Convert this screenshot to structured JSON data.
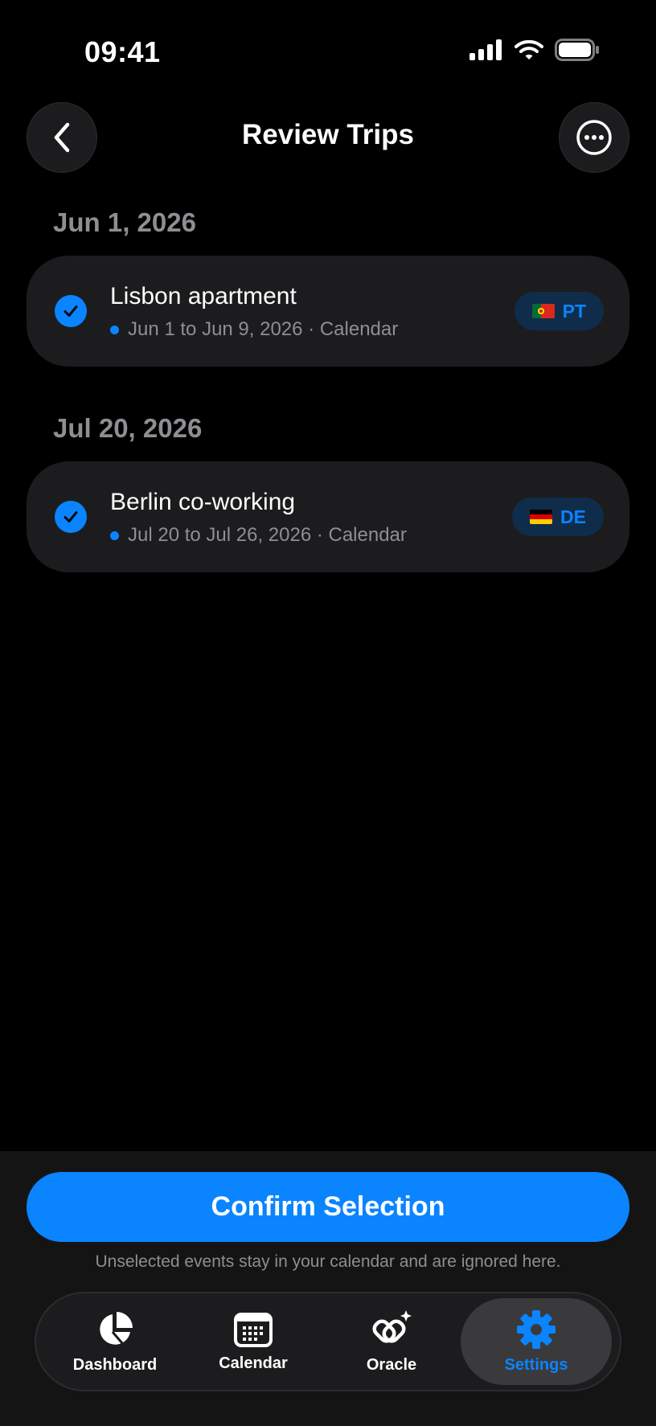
{
  "status_bar": {
    "time": "09:41"
  },
  "nav": {
    "title": "Review Trips"
  },
  "sections": [
    {
      "date": "Jun 1, 2026",
      "trip": {
        "title": "Lisbon apartment",
        "subtitle": "Jun 1 to Jun 9, 2026 · Calendar",
        "country_code": "PT",
        "selected": true
      }
    },
    {
      "date": "Jul 20, 2026",
      "trip": {
        "title": "Berlin co-working",
        "subtitle": "Jul 20 to Jul 26, 2026 · Calendar",
        "country_code": "DE",
        "selected": true
      }
    }
  ],
  "footer": {
    "confirm_label": "Confirm Selection",
    "hint": "Unselected events stay in your calendar and are ignored here."
  },
  "tabs": [
    {
      "label": "Dashboard",
      "icon": "pie-chart-icon",
      "active": false
    },
    {
      "label": "Calendar",
      "icon": "calendar-icon",
      "active": false
    },
    {
      "label": "Oracle",
      "icon": "oracle-sparkle-icon",
      "active": false
    },
    {
      "label": "Settings",
      "icon": "gear-icon",
      "active": true
    }
  ],
  "colors": {
    "accent": "#0a84ff",
    "card": "#1c1c1e",
    "secondary_text": "#8e8e93"
  }
}
